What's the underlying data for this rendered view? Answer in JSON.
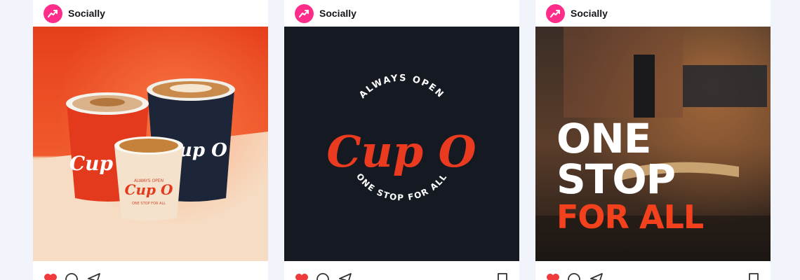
{
  "feed": {
    "posts": [
      {
        "author": "Socially",
        "media": {
          "kind": "product-cups",
          "cup_brand": "Cup O",
          "cup_small_text_top": "ALWAYS OPEN",
          "cup_small_text_bottom": "ONE STOP FOR ALL",
          "colors": {
            "background": "#e8431c",
            "table": "#f5dcc1",
            "cup_red": "#e33a1d",
            "cup_navy": "#1c2538",
            "cup_cream": "#f4e2cc"
          }
        },
        "actions": [
          "heart-icon",
          "comment-icon",
          "share-icon"
        ]
      },
      {
        "author": "Socially",
        "media": {
          "kind": "logo",
          "arc_top": "ALWAYS OPEN",
          "logo_text": "Cup O",
          "registered": "®",
          "arc_bottom": "ONE STOP FOR ALL",
          "colors": {
            "background": "#151a22",
            "logo": "#ea3a1f",
            "text": "#ffffff"
          }
        },
        "actions": [
          "heart-icon",
          "comment-icon",
          "share-icon",
          "bookmark-icon"
        ]
      },
      {
        "author": "Socially",
        "media": {
          "kind": "cafe-interior",
          "headline_line1": "ONE",
          "headline_line2": "STOP",
          "headline_line3": "FOR ALL",
          "colors": {
            "headline_white": "#ffffff",
            "headline_accent": "#f3411e"
          }
        },
        "actions": [
          "heart-icon",
          "comment-icon",
          "share-icon",
          "bookmark-icon"
        ]
      }
    ]
  },
  "colors": {
    "accent_pink": "#ff2d8a",
    "like_red": "#ef3b3b",
    "page_bg": "#f2f4fb"
  }
}
